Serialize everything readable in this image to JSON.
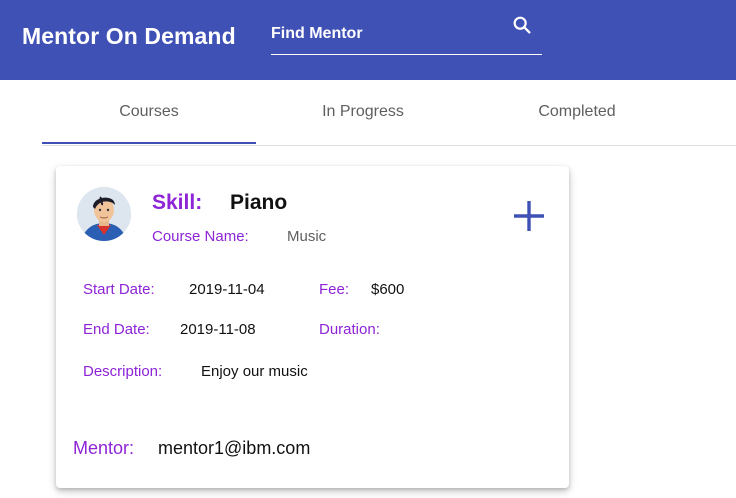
{
  "header": {
    "brand": "Mentor On Demand",
    "search_placeholder": "Find Mentor",
    "search_icon": "search-icon",
    "background_color": "#3f51b5"
  },
  "tabs": [
    {
      "label": "Courses",
      "active": true
    },
    {
      "label": "In Progress",
      "active": false
    },
    {
      "label": "Completed",
      "active": false
    }
  ],
  "card": {
    "avatar_icon": "avatar-icon",
    "skill_label": "Skill:",
    "skill_value": "Piano",
    "course_label": "Course Name:",
    "course_value": "Music",
    "add_icon": "plus-icon",
    "start_date_label": "Start Date:",
    "start_date_value": "2019-11-04",
    "fee_label": "Fee:",
    "fee_value": "$600",
    "end_date_label": "End Date:",
    "end_date_value": "2019-11-08",
    "duration_label": "Duration:",
    "duration_value": "",
    "description_label": "Description:",
    "description_value": "Enjoy our music",
    "mentor_label": "Mentor:",
    "mentor_value": "mentor1@ibm.com"
  },
  "colors": {
    "primary": "#3f51b5",
    "accent_label": "#8e24d6",
    "tab_text": "#5f5f5f"
  }
}
